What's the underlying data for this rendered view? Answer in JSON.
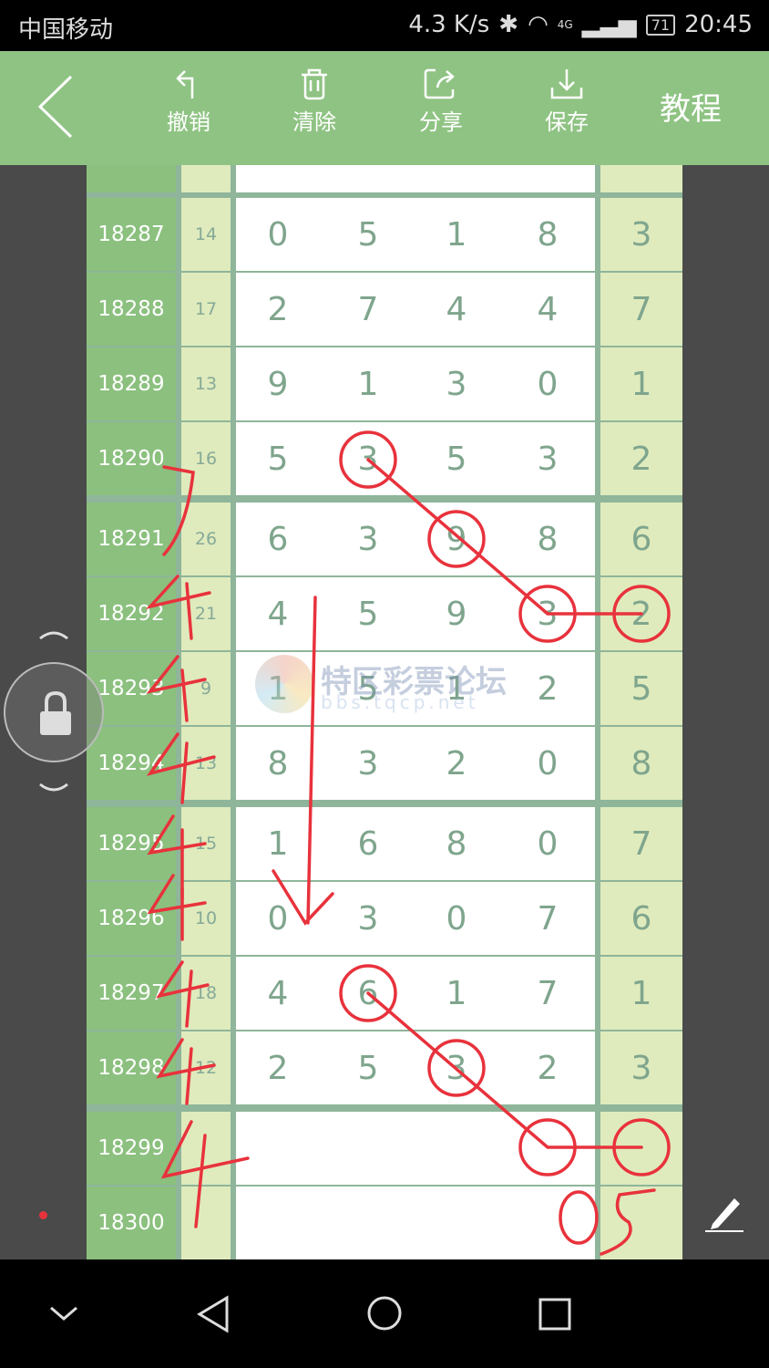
{
  "status_bar": {
    "carrier": "中国移动",
    "speed": "4.3 K/s",
    "network": "4G",
    "battery": "71",
    "time": "20:45"
  },
  "toolbar": {
    "back_icon": "chevron-left-icon",
    "undo": "撤销",
    "clear": "清除",
    "share": "分享",
    "save": "保存",
    "tutorial": "教程"
  },
  "watermark": {
    "name": "特区彩票论坛",
    "url": "bbs.tqcp.net"
  },
  "rows": [
    {
      "period": "18287",
      "sum": "14",
      "digits": [
        "0",
        "5",
        "1",
        "8"
      ],
      "last": "3"
    },
    {
      "period": "18288",
      "sum": "17",
      "digits": [
        "2",
        "7",
        "4",
        "4"
      ],
      "last": "7"
    },
    {
      "period": "18289",
      "sum": "13",
      "digits": [
        "9",
        "1",
        "3",
        "0"
      ],
      "last": "1"
    },
    {
      "period": "18290",
      "sum": "16",
      "digits": [
        "5",
        "3",
        "5",
        "3"
      ],
      "last": "2"
    },
    {
      "period": "18291",
      "sum": "26",
      "digits": [
        "6",
        "3",
        "9",
        "8"
      ],
      "last": "6"
    },
    {
      "period": "18292",
      "sum": "21",
      "digits": [
        "4",
        "5",
        "9",
        "3"
      ],
      "last": "2"
    },
    {
      "period": "18293",
      "sum": "9",
      "digits": [
        "1",
        "5",
        "1",
        "2"
      ],
      "last": "5"
    },
    {
      "period": "18294",
      "sum": "13",
      "digits": [
        "8",
        "3",
        "2",
        "0"
      ],
      "last": "8"
    },
    {
      "period": "18295",
      "sum": "15",
      "digits": [
        "1",
        "6",
        "8",
        "0"
      ],
      "last": "7"
    },
    {
      "period": "18296",
      "sum": "10",
      "digits": [
        "0",
        "3",
        "0",
        "7"
      ],
      "last": "6"
    },
    {
      "period": "18297",
      "sum": "18",
      "digits": [
        "4",
        "6",
        "1",
        "7"
      ],
      "last": "1"
    },
    {
      "period": "18298",
      "sum": "12",
      "digits": [
        "2",
        "5",
        "3",
        "2"
      ],
      "last": "3"
    },
    {
      "period": "18299",
      "sum": "",
      "digits": [
        "",
        "",
        "",
        ""
      ],
      "last": ""
    },
    {
      "period": "18300",
      "sum": "",
      "digits": [
        "",
        "",
        "",
        ""
      ],
      "last": ""
    }
  ],
  "annotation_color": "#e8323c",
  "accent": "#8fc383"
}
